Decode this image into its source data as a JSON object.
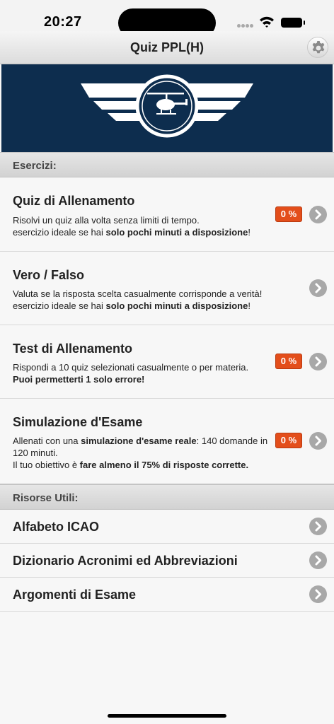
{
  "status_bar": {
    "time": "20:27"
  },
  "nav": {
    "title": "Quiz PPL(H)",
    "settings_icon": "gear-icon"
  },
  "banner": {
    "logo": "helicopter-wings-logo",
    "background": "#0d2d4e"
  },
  "sections": {
    "exercises": "Esercizi:",
    "resources": "Risorse Utili:"
  },
  "exercises": [
    {
      "title": "Quiz di Allenamento",
      "line1": "Risolvi un quiz alla volta senza limiti di tempo.",
      "line2_pre": "esercizio ideale se hai ",
      "line2_bold": "solo pochi minuti a disposizione",
      "line2_post": "!",
      "badge": "0 %"
    },
    {
      "title": "Vero / Falso",
      "line1": "Valuta se la risposta scelta casualmente corrisponde a verità!",
      "line2_pre": "esercizio ideale se hai ",
      "line2_bold": "solo pochi minuti a disposizione",
      "line2_post": "!"
    },
    {
      "title": "Test di Allenamento",
      "line1": "Rispondi a 10 quiz selezionati casualmente o per materia.",
      "line2_bold": "Puoi permetterti 1 solo errore!",
      "badge": "0 %"
    },
    {
      "title": "Simulazione d'Esame",
      "line1_pre": "Allenati con una ",
      "line1_bold": "simulazione d'esame reale",
      "line1_post": ": 140 domande in",
      "line2": "120 minuti.",
      "line3_pre": "Il tuo obiettivo è ",
      "line3_bold": "fare almeno il 75% di risposte corrette.",
      "badge": "0 %"
    }
  ],
  "resources": [
    {
      "title": "Alfabeto ICAO"
    },
    {
      "title": "Dizionario Acronimi ed Abbreviazioni"
    },
    {
      "title": "Argomenti di Esame"
    }
  ],
  "colors": {
    "badge": "#e34e1b",
    "chevron": "#a8a8a8"
  }
}
